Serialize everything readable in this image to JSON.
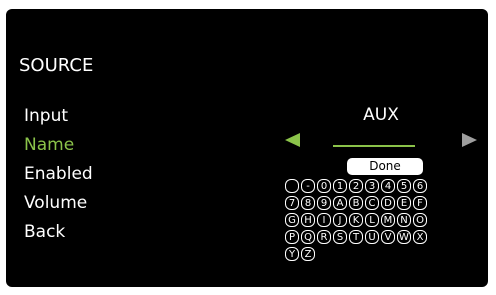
{
  "screen": {
    "title": "SOURCE",
    "menu": [
      "Input",
      "Name",
      "Enabled",
      "Volume",
      "Back"
    ],
    "selected_menu": "Name",
    "value": "AUX",
    "done_label": "Done"
  },
  "keyboard": {
    "rows": [
      [
        " ",
        "-",
        "0",
        "1",
        "2",
        "3",
        "4",
        "5",
        "6"
      ],
      [
        "7",
        "8",
        "9",
        "A",
        "B",
        "C",
        "D",
        "E",
        "F"
      ],
      [
        "G",
        "H",
        "I",
        "J",
        "K",
        "L",
        "M",
        "N",
        "O"
      ],
      [
        "P",
        "Q",
        "R",
        "S",
        "T",
        "U",
        "V",
        "W",
        "X"
      ],
      [
        "Y",
        "Z"
      ]
    ]
  },
  "colors": {
    "accent": "#8bc34a",
    "inactive": "#9e9e9e",
    "background": "#000000"
  }
}
